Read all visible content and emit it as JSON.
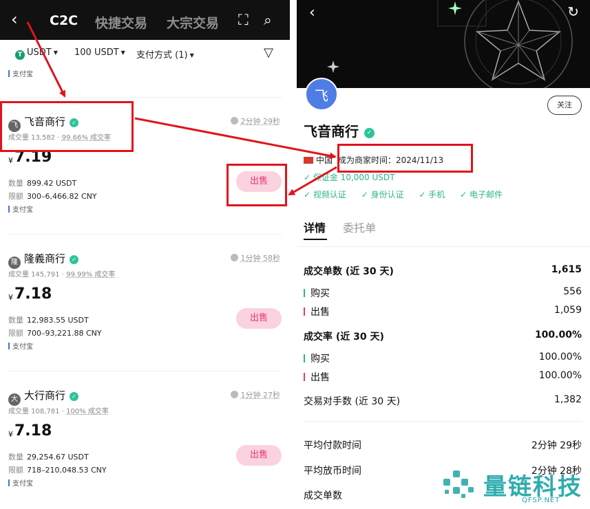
{
  "left": {
    "header": {
      "tabs": [
        "C2C",
        "快捷交易",
        "大宗交易"
      ],
      "active_tab": "C2C"
    },
    "filters": {
      "coin": "USDT",
      "amount": "100 USDT",
      "payment": "支付方式 (1)"
    },
    "top_payment": "支付宝",
    "merchants": [
      {
        "name": "飞音商行",
        "avatar": "飞",
        "trades": "成交量 13,582",
        "rate": "99.66% 成交率",
        "time": "2分钟 29秒",
        "currency": "¥",
        "price": "7.19",
        "qty_label": "数量",
        "qty": "899.42 USDT",
        "limit_label": "限额",
        "limit": "300–6,466.82 CNY",
        "payment": "支付宝",
        "action": "出售"
      },
      {
        "name": "隆義商行",
        "avatar": "隆",
        "trades": "成交量 145,791",
        "rate": "99.99% 成交率",
        "time": "1分钟 58秒",
        "currency": "¥",
        "price": "7.18",
        "qty_label": "数量",
        "qty": "12,983.55 USDT",
        "limit_label": "限额",
        "limit": "700–93,221.88 CNY",
        "payment": "支付宝",
        "action": "出售"
      },
      {
        "name": "大行商行",
        "avatar": "大",
        "trades": "成交量 108,781",
        "rate": "100% 成交率",
        "time": "1分钟 27秒",
        "currency": "¥",
        "price": "7.18",
        "qty_label": "数量",
        "qty": "29,254.67 USDT",
        "limit_label": "限额",
        "limit": "718–210,048.53 CNY",
        "payment": "支付宝",
        "action": "出售"
      }
    ]
  },
  "right": {
    "avatar": "飞",
    "follow": "关注",
    "name": "飞音商行",
    "country": "中国",
    "merchant_since": "成为商家时间：2024/11/13",
    "deposit": "✓ 保证金 10,000 USDT",
    "verifications": [
      "✓ 视频认证",
      "✓ 身份认证",
      "✓ 手机",
      "✓ 电子邮件"
    ],
    "tabs": [
      "详情",
      "委托单"
    ],
    "stats": [
      {
        "label": "成交单数 (近 30 天)",
        "value": "1,615",
        "bold": true
      },
      {
        "label": "购买",
        "value": "556",
        "bar": "green"
      },
      {
        "label": "出售",
        "value": "1,059",
        "bar": "red"
      },
      {
        "label": "成交率 (近 30 天)",
        "value": "100.00%",
        "bold": true
      },
      {
        "label": "购买",
        "value": "100.00%",
        "bar": "green"
      },
      {
        "label": "出售",
        "value": "100.00%",
        "bar": "red"
      },
      {
        "label": "交易对手数 (近 30 天)",
        "value": "1,382"
      },
      {
        "label": "平均付款时间",
        "value": "2分钟 29秒"
      },
      {
        "label": "平均放币时间",
        "value": "2分钟 28秒"
      },
      {
        "label": "成交单数",
        "value": ""
      }
    ]
  },
  "watermark": {
    "name": "量链科技",
    "site": "QFSP.NET"
  },
  "colors": {
    "accent_green": "#2cb48b",
    "sell_pink": "#fbd2df",
    "sell_text": "#e8386e",
    "annotation_red": "#e1131b"
  }
}
